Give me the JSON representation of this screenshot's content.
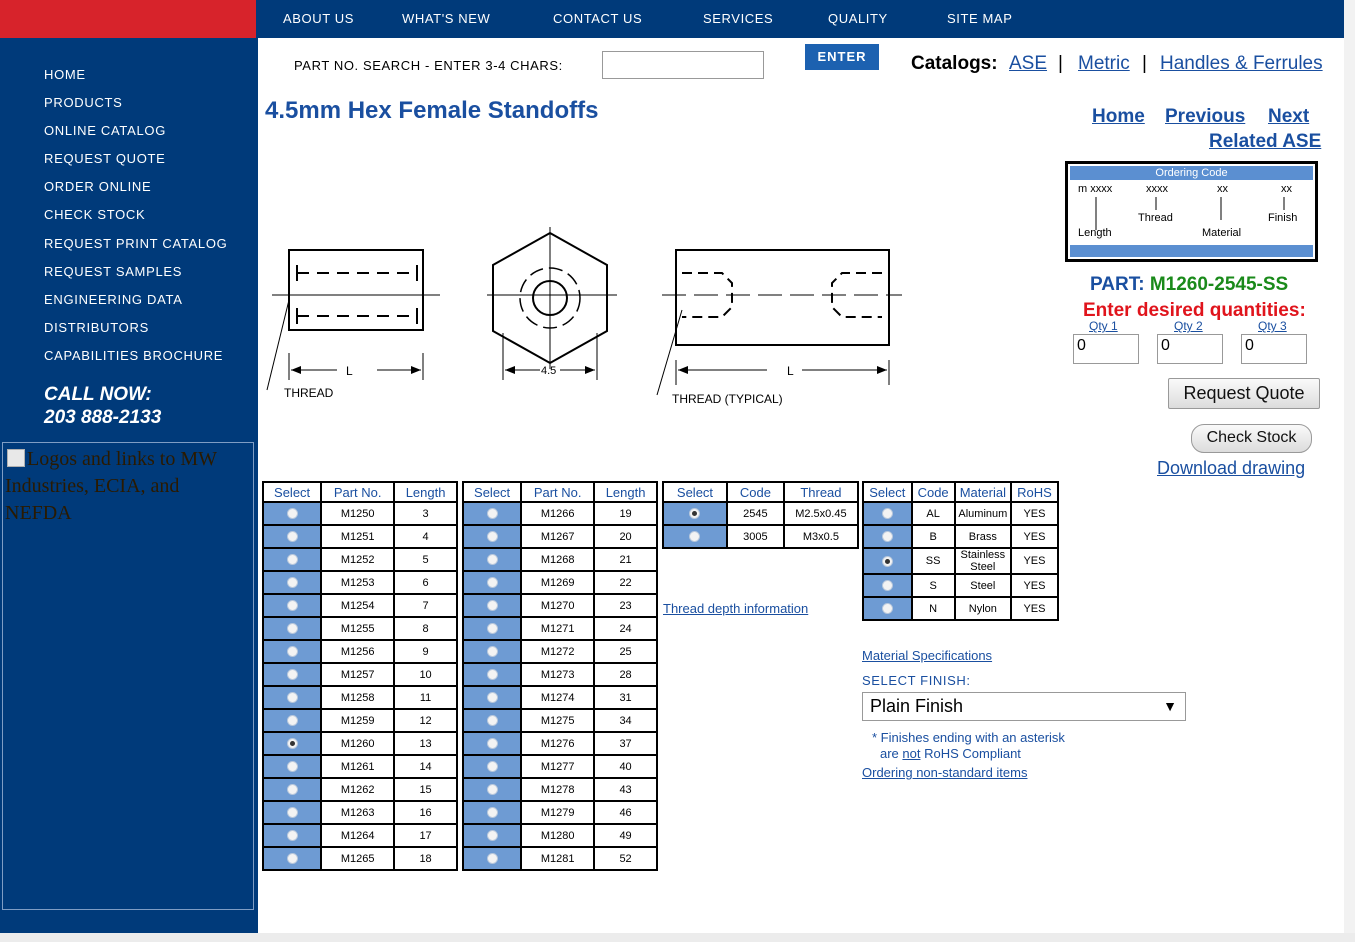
{
  "topnav": [
    "ABOUT US",
    "WHAT'S NEW",
    "CONTACT US",
    "SERVICES",
    "QUALITY",
    "SITE MAP"
  ],
  "sidebar": {
    "items": [
      "HOME",
      "PRODUCTS",
      "ONLINE CATALOG",
      "REQUEST QUOTE",
      "ORDER ONLINE",
      "CHECK STOCK",
      "REQUEST PRINT CATALOG",
      "REQUEST SAMPLES",
      "ENGINEERING DATA",
      "DISTRIBUTORS",
      "CAPABILITIES BROCHURE"
    ],
    "call_now": "CALL NOW:",
    "phone": "203 888-2133",
    "logo_alt": "Logos and links to MW Industries, ECIA, and NEFDA"
  },
  "search": {
    "label": "PART NO. SEARCH - ENTER 3-4 CHARS:",
    "value": "",
    "enter_label": "ENTER"
  },
  "catalogs": {
    "label": "Catalogs:",
    "links": [
      "ASE",
      "Metric",
      "Handles & Ferrules"
    ],
    "separator": "|"
  },
  "page_title": "4.5mm Hex Female Standoffs",
  "pager": {
    "home": "Home",
    "previous": "Previous",
    "next": "Next",
    "related": "Related ASE"
  },
  "ordering_code": {
    "title": "Ordering Code",
    "codes": [
      "m xxxx",
      "xxxx",
      "xx",
      "xx"
    ],
    "labels": [
      "Length",
      "Thread",
      "Material",
      "Finish"
    ]
  },
  "drawing": {
    "label_L": "L",
    "label_thread": "THREAD",
    "label_45": "4.5",
    "label_thread_typical": "THREAD (TYPICAL)"
  },
  "part": {
    "label": "PART:",
    "value": "M1260-2545-SS"
  },
  "quantities": {
    "prompt": "Enter desired quantities:",
    "labels": [
      "Qty 1",
      "Qty 2",
      "Qty 3"
    ],
    "values": [
      "0",
      "0",
      "0"
    ]
  },
  "buttons": {
    "request_quote": "Request Quote",
    "check_stock": "Check Stock",
    "download": "Download drawing"
  },
  "length_headers": [
    "Select",
    "Part No.",
    "Length"
  ],
  "length_table_1": [
    {
      "part": "M1250",
      "length": "3",
      "selected": false
    },
    {
      "part": "M1251",
      "length": "4",
      "selected": false
    },
    {
      "part": "M1252",
      "length": "5",
      "selected": false
    },
    {
      "part": "M1253",
      "length": "6",
      "selected": false
    },
    {
      "part": "M1254",
      "length": "7",
      "selected": false
    },
    {
      "part": "M1255",
      "length": "8",
      "selected": false
    },
    {
      "part": "M1256",
      "length": "9",
      "selected": false
    },
    {
      "part": "M1257",
      "length": "10",
      "selected": false
    },
    {
      "part": "M1258",
      "length": "11",
      "selected": false
    },
    {
      "part": "M1259",
      "length": "12",
      "selected": false
    },
    {
      "part": "M1260",
      "length": "13",
      "selected": true
    },
    {
      "part": "M1261",
      "length": "14",
      "selected": false
    },
    {
      "part": "M1262",
      "length": "15",
      "selected": false
    },
    {
      "part": "M1263",
      "length": "16",
      "selected": false
    },
    {
      "part": "M1264",
      "length": "17",
      "selected": false
    },
    {
      "part": "M1265",
      "length": "18",
      "selected": false
    }
  ],
  "length_table_2": [
    {
      "part": "M1266",
      "length": "19",
      "selected": false
    },
    {
      "part": "M1267",
      "length": "20",
      "selected": false
    },
    {
      "part": "M1268",
      "length": "21",
      "selected": false
    },
    {
      "part": "M1269",
      "length": "22",
      "selected": false
    },
    {
      "part": "M1270",
      "length": "23",
      "selected": false
    },
    {
      "part": "M1271",
      "length": "24",
      "selected": false
    },
    {
      "part": "M1272",
      "length": "25",
      "selected": false
    },
    {
      "part": "M1273",
      "length": "28",
      "selected": false
    },
    {
      "part": "M1274",
      "length": "31",
      "selected": false
    },
    {
      "part": "M1275",
      "length": "34",
      "selected": false
    },
    {
      "part": "M1276",
      "length": "37",
      "selected": false
    },
    {
      "part": "M1277",
      "length": "40",
      "selected": false
    },
    {
      "part": "M1278",
      "length": "43",
      "selected": false
    },
    {
      "part": "M1279",
      "length": "46",
      "selected": false
    },
    {
      "part": "M1280",
      "length": "49",
      "selected": false
    },
    {
      "part": "M1281",
      "length": "52",
      "selected": false
    }
  ],
  "thread_headers": [
    "Select",
    "Code",
    "Thread"
  ],
  "thread_table": [
    {
      "code": "2545",
      "thread": "M2.5x0.45",
      "selected": true
    },
    {
      "code": "3005",
      "thread": "M3x0.5",
      "selected": false
    }
  ],
  "thread_depth_link": "Thread depth information",
  "material_headers": [
    "Select",
    "Code",
    "Material",
    "RoHS"
  ],
  "material_table": [
    {
      "code": "AL",
      "material": "Aluminum",
      "rohs": "YES",
      "selected": false
    },
    {
      "code": "B",
      "material": "Brass",
      "rohs": "YES",
      "selected": false
    },
    {
      "code": "SS",
      "material": "Stainless Steel",
      "rohs": "YES",
      "selected": true
    },
    {
      "code": "S",
      "material": "Steel",
      "rohs": "YES",
      "selected": false
    },
    {
      "code": "N",
      "material": "Nylon",
      "rohs": "YES",
      "selected": false
    }
  ],
  "finish": {
    "material_specs_link": "Material Specifications",
    "label": "SELECT FINISH:",
    "selected": "Plain Finish",
    "arrow": "▼",
    "note_line1": "* Finishes ending with an asterisk",
    "note_prefix": "are ",
    "note_not": "not",
    "note_suffix": " RoHS Compliant",
    "nonstandard_link": "Ordering non-standard items"
  }
}
